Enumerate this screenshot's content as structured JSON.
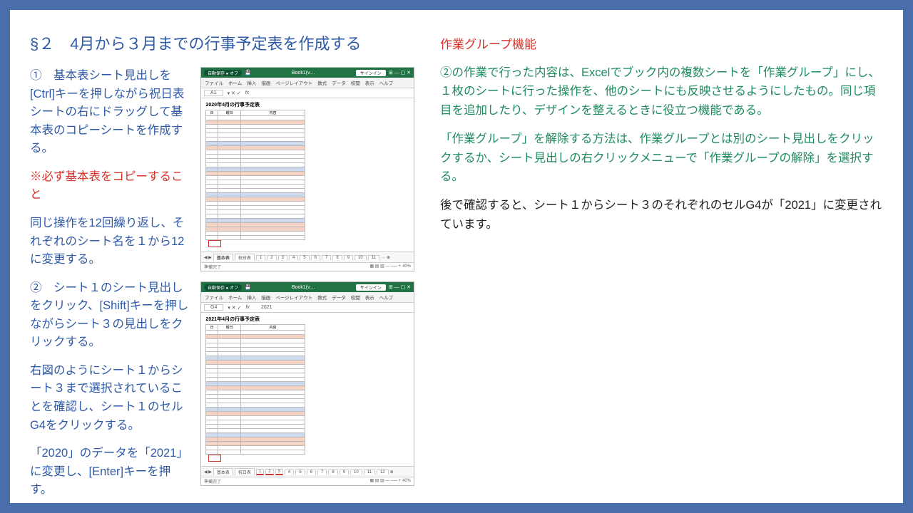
{
  "title": "§２　4月から３月までの行事予定表を作成する",
  "left": {
    "s1": "①　基本表シート見出しを[Ctrl]キーを押しながら祝日表シートの右にドラッグして基本表のコピーシートを作成する。",
    "warn": "※必ず基本表をコピーすること",
    "s2": "同じ操作を12回繰り返し、それぞれのシート名を１から12に変更する。",
    "s3": "②　シート１のシート見出しをクリック、[Shift]キーを押しながらシート３の見出しをクリックする。",
    "s4": "右図のようにシート１からシート３まで選択されていることを確認し、シート１のセルG4をクリックする。",
    "s5": "「2020」のデータを「2021」に変更し、[Enter]キーを押す。"
  },
  "right": {
    "h2": "作業グループ機能",
    "p1": "②の作業で行った内容は、Excelでブック内の複数シートを「作業グループ」にし、１枚のシートに行った操作を、他のシートにも反映させるようにしたもの。同じ項目を追加したり、デザインを整えるときに役立つ機能である。",
    "p2": "「作業グループ」を解除する方法は、作業グループとは別のシート見出しをクリックするか、シート見出しの右クリックメニューで「作業グループの解除」を選択する。",
    "p3": "後で確認すると、シート１からシート３のそれぞれのセルG4が「2021」に変更されています。"
  },
  "excel": {
    "autosave": "自動保存",
    "off": "オフ",
    "book": "Book1(v…",
    "signin": "サインイン",
    "menu": [
      "ファイル",
      "ホーム",
      "挿入",
      "描画",
      "ページレイアウト",
      "数式",
      "データ",
      "校閲",
      "表示",
      "ヘルプ"
    ],
    "a1": "A1",
    "g4": "G4",
    "fx": "fx",
    "val2021": "2021",
    "tabletitle1": "2020年4月の行事予定表",
    "tabletitle2": "2021年4月の行事予定表",
    "hdr": [
      "日",
      "曜日",
      "内容"
    ],
    "tabs": {
      "base": "基本表",
      "holiday": "祝日表",
      "nums": [
        "1",
        "2",
        "3",
        "4",
        "5",
        "6",
        "7",
        "8",
        "9",
        "10",
        "11",
        "12"
      ]
    },
    "ready": "準備完了"
  }
}
